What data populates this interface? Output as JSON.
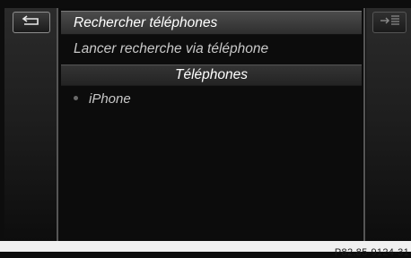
{
  "menu": {
    "back_icon": "back-arrow-icon",
    "options_icon": "options-list-icon",
    "items": [
      {
        "label": "Rechercher téléphones",
        "selected": true
      },
      {
        "label": "Lancer recherche via téléphone",
        "selected": false
      }
    ],
    "section_header": "Téléphones",
    "devices": [
      {
        "label": "iPhone"
      }
    ]
  },
  "footer": {
    "reference": "P82.85-9124-31"
  },
  "colors": {
    "background": "#0d0d0d",
    "selected_row": "#3e3e3e",
    "text_primary": "#ffffff",
    "text_secondary": "#c8c8c8"
  }
}
